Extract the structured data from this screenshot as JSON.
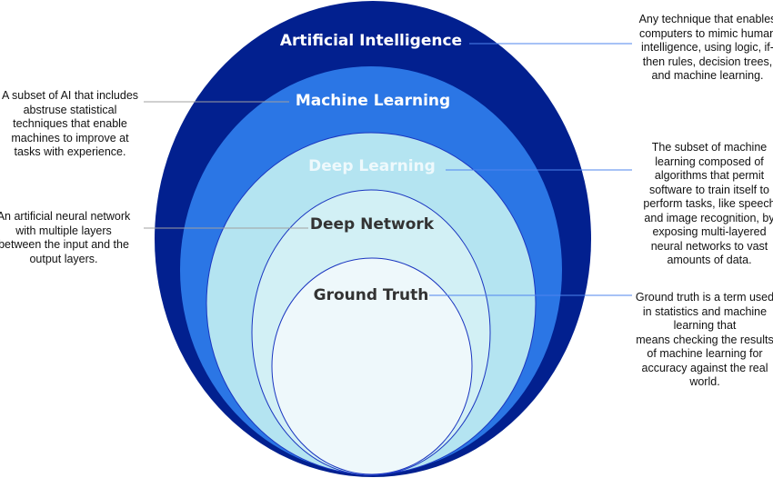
{
  "colors": {
    "ai": "#02208f",
    "ml": "#2b76e5",
    "dl": "#b4e4f1",
    "dn": "#d2f0f5",
    "gt": "#eef8fb",
    "outline": "#1a35c0",
    "leader_blue": "#4f84ee",
    "leader_grey": "#a0a0a0"
  },
  "layers": [
    {
      "label": "Artificial Intelligence",
      "description": "Any technique that enables\ncomputers to mimic human\nintelligence, using logic, if-\nthen rules, decision trees,\nand machine learning."
    },
    {
      "label": "Machine Learning",
      "description": "A subset of AI that includes\nabstruse statistical\ntechniques that enable\nmachines to improve at\ntasks with experience."
    },
    {
      "label": "Deep Learning",
      "description": "The subset of machine\nlearning composed of\nalgorithms that permit\nsoftware to train itself to\nperform tasks, like speech\nand image recognition, by\nexposing multi-layered\nneural networks to vast\namounts of data."
    },
    {
      "label": "Deep Network",
      "description": "An artificial neural network\nwith multiple layers\nbetween the input and the\noutput layers."
    },
    {
      "label": "Ground Truth",
      "description": "Ground truth is a term used\nin statistics and machine\nlearning that\nmeans checking the results\nof machine learning for\naccuracy against the real\nworld."
    }
  ]
}
